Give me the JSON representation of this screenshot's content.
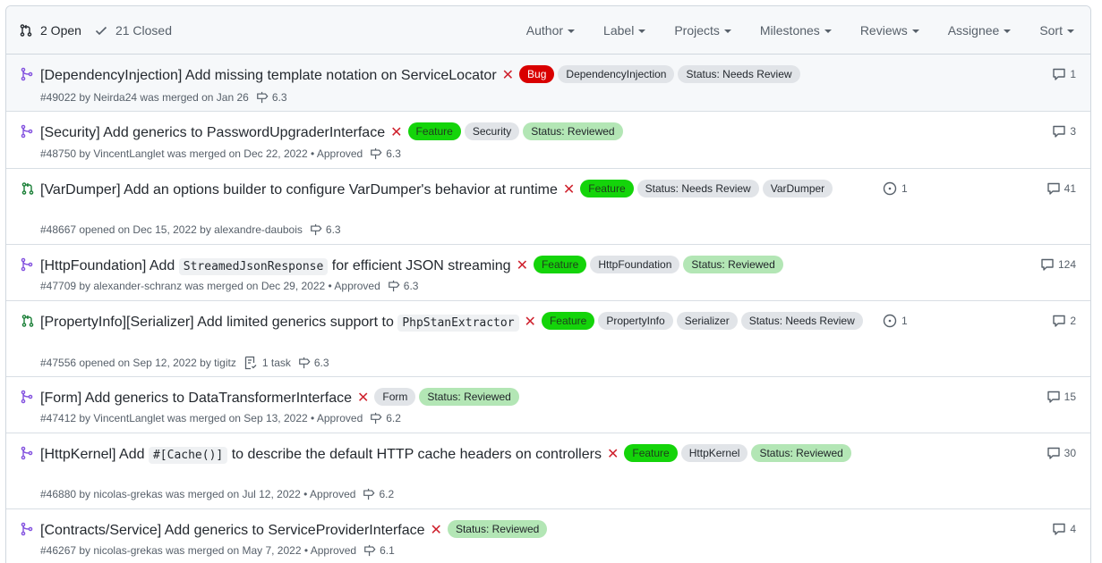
{
  "header": {
    "open_label": "2 Open",
    "closed_label": "21 Closed",
    "filters": [
      "Author",
      "Label",
      "Projects",
      "Milestones",
      "Reviews",
      "Assignee",
      "Sort"
    ]
  },
  "colors": {
    "merged": "#8250df",
    "open": "#1a7f37",
    "closed_x": "#cf222e"
  },
  "rows": [
    {
      "status": "merged",
      "title": "[DependencyInjection] Add missing template notation on ServiceLocator",
      "labels": [
        {
          "text": "Bug",
          "style": "red"
        },
        {
          "text": "DependencyInjection",
          "style": "grey"
        },
        {
          "text": "Status: Needs Review",
          "style": "grey"
        }
      ],
      "meta": "#49022 by Neirda24 was merged on Jan 26",
      "milestone": "6.3",
      "comments": "1"
    },
    {
      "status": "merged",
      "title": "[Security] Add generics to PasswordUpgraderInterface",
      "labels": [
        {
          "text": "Feature",
          "style": "green"
        },
        {
          "text": "Security",
          "style": "grey"
        },
        {
          "text": "Status: Reviewed",
          "style": "lgreen"
        }
      ],
      "meta": "#48750 by VincentLanglet was merged on Dec 22, 2022 • Approved",
      "milestone": "6.3",
      "comments": "3"
    },
    {
      "status": "open",
      "title": "[VarDumper] Add an options builder to configure VarDumper's behavior at runtime",
      "labels": [
        {
          "text": "Feature",
          "style": "green"
        },
        {
          "text": "Status: Needs Review",
          "style": "grey"
        },
        {
          "text": "VarDumper",
          "style": "grey"
        }
      ],
      "meta": "#48667 opened on Dec 15, 2022 by alexandre-daubois",
      "milestone": "6.3",
      "comments": "41",
      "linked": "1"
    },
    {
      "status": "merged",
      "title_pre": "[HttpFoundation] Add ",
      "title_code": "StreamedJsonResponse",
      "title_post": " for efficient JSON streaming",
      "labels": [
        {
          "text": "Feature",
          "style": "green"
        },
        {
          "text": "HttpFoundation",
          "style": "grey"
        },
        {
          "text": "Status: Reviewed",
          "style": "lgreen"
        }
      ],
      "meta": "#47709 by alexander-schranz was merged on Dec 29, 2022 • Approved",
      "milestone": "6.3",
      "comments": "124"
    },
    {
      "status": "open",
      "title_pre": "[PropertyInfo][Serializer] Add limited generics support to ",
      "title_code": "PhpStanExtractor",
      "title_post": "",
      "labels": [
        {
          "text": "Feature",
          "style": "green"
        },
        {
          "text": "PropertyInfo",
          "style": "grey"
        },
        {
          "text": "Serializer",
          "style": "grey"
        },
        {
          "text": "Status: Needs Review",
          "style": "grey"
        }
      ],
      "meta": "#47556 opened on Sep 12, 2022 by tigitz",
      "task": "1 task",
      "milestone": "6.3",
      "comments": "2",
      "linked": "1"
    },
    {
      "status": "merged",
      "title": "[Form] Add generics to DataTransformerInterface",
      "labels": [
        {
          "text": "Form",
          "style": "grey"
        },
        {
          "text": "Status: Reviewed",
          "style": "lgreen"
        }
      ],
      "meta": "#47412 by VincentLanglet was merged on Sep 13, 2022 • Approved",
      "milestone": "6.2",
      "comments": "15"
    },
    {
      "status": "merged",
      "title_pre": "[HttpKernel] Add ",
      "title_code": "#[Cache()]",
      "title_post": " to describe the default HTTP cache headers on controllers",
      "labels": [
        {
          "text": "Feature",
          "style": "green"
        },
        {
          "text": "HttpKernel",
          "style": "grey"
        },
        {
          "text": "Status: Reviewed",
          "style": "lgreen"
        }
      ],
      "meta": "#46880 by nicolas-grekas was merged on Jul 12, 2022 • Approved",
      "milestone": "6.2",
      "comments": "30"
    },
    {
      "status": "merged",
      "title": "[Contracts/Service] Add generics to ServiceProviderInterface",
      "labels": [
        {
          "text": "Status: Reviewed",
          "style": "lgreen"
        }
      ],
      "meta": "#46267 by nicolas-grekas was merged on May 7, 2022 • Approved",
      "milestone": "6.1",
      "comments": "4"
    }
  ]
}
